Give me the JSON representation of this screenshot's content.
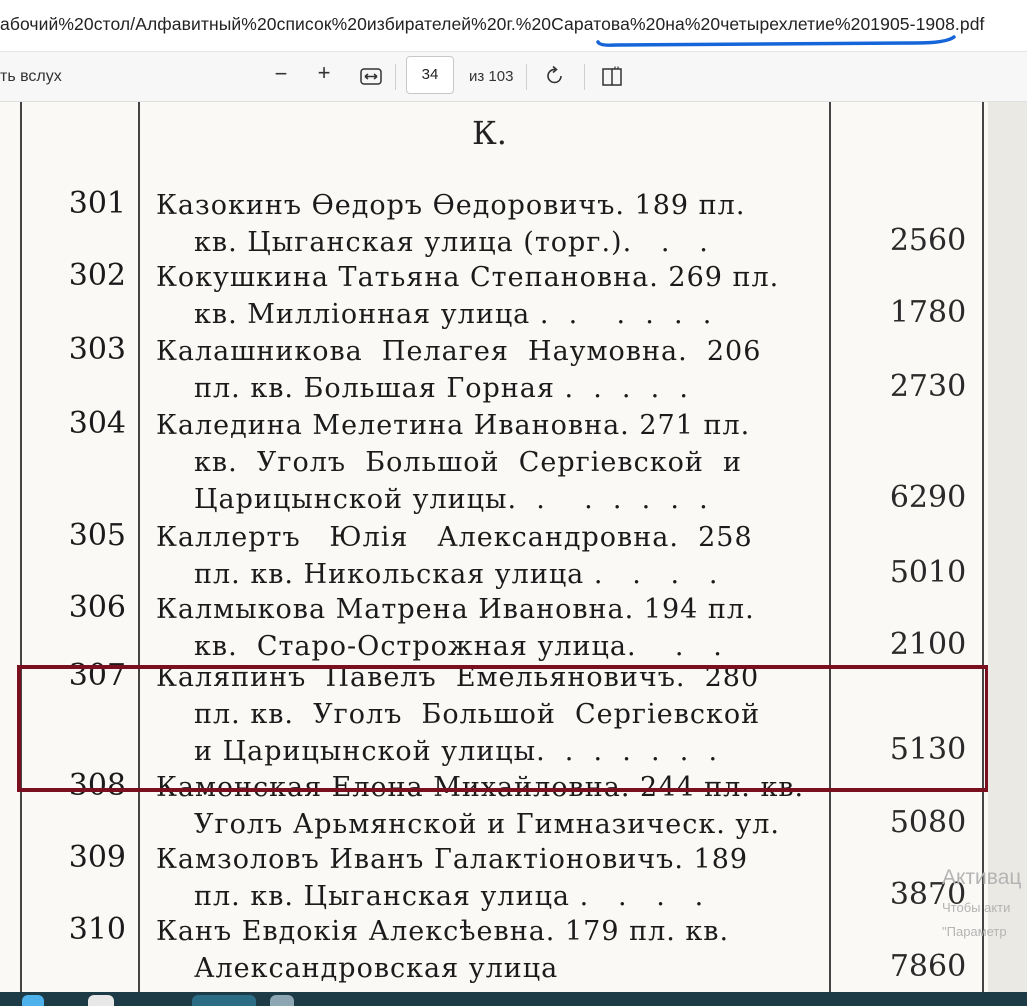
{
  "address_bar": {
    "url": "абочий%20стол/Алфавитный%20список%20избирателей%20г.%20Саратова%20на%20четырехлетие%201905-1908.pdf"
  },
  "toolbar": {
    "read_aloud": "ть вслух",
    "zoom_out": "−",
    "zoom_in": "+",
    "page_number": "34",
    "page_total": "из 103"
  },
  "document": {
    "section_letter": "К.",
    "entries": [
      {
        "number": "301",
        "lines": [
          "Казокинъ Өедоръ Өедоровичъ. 189 пл.",
          "кв. Цыганская улица (торг.).   .   ."
        ],
        "amount": "2560"
      },
      {
        "number": "302",
        "lines": [
          "Кокушкина Татьяна Степановна. 269 пл.",
          "кв. Милліонная улица .  .    .  .  .  ."
        ],
        "amount": "1780"
      },
      {
        "number": "303",
        "lines": [
          "Калашникова  Пелагея  Наумовна.  206",
          "пл. кв. Большая Горная .  .  .  .  ."
        ],
        "amount": "2730"
      },
      {
        "number": "304",
        "lines": [
          "Каледина Мелетина Ивановна. 271 пл.",
          "кв.  Уголъ  Большой  Сергіевской  и",
          "Царицынской улицы.  .    .  .  .  .  ."
        ],
        "amount": "6290"
      },
      {
        "number": "305",
        "lines": [
          "Каллертъ   Юлія   Александровна.  258",
          "пл. кв. Никольская улица .   .   .   ."
        ],
        "amount": "5010"
      },
      {
        "number": "306",
        "lines": [
          "Калмыкова Матрена Ивановна. 194 пл.",
          "кв.  Старо-Острожная улица.    .   ."
        ],
        "amount": "2100"
      },
      {
        "number": "307",
        "lines": [
          "Каляпинъ  Павелъ  Емельяновичъ.  280",
          "пл. кв.  Уголъ  Большой  Сергіевской",
          "и Царицынской улицы.  .  .  .  .  .  ."
        ],
        "amount": "5130"
      },
      {
        "number": "308",
        "lines": [
          "Каменская Елена Михайловна. 244 пл. кв.",
          "Уголъ Арьмянской и Гимназическ. ул."
        ],
        "amount": "5080"
      },
      {
        "number": "309",
        "lines": [
          "Камзоловъ Иванъ Галактіоновичъ. 189",
          "пл. кв. Цыганская улица .   .   .   ."
        ],
        "amount": "3870"
      },
      {
        "number": "310",
        "lines": [
          "Канъ Евдокія Алексѣевна. 179 пл. кв.",
          "Александровская улица"
        ],
        "amount": "7860"
      }
    ]
  },
  "watermark": {
    "title": "Активац",
    "line1": "Чтобы акти",
    "line2": "\"Параметр"
  }
}
